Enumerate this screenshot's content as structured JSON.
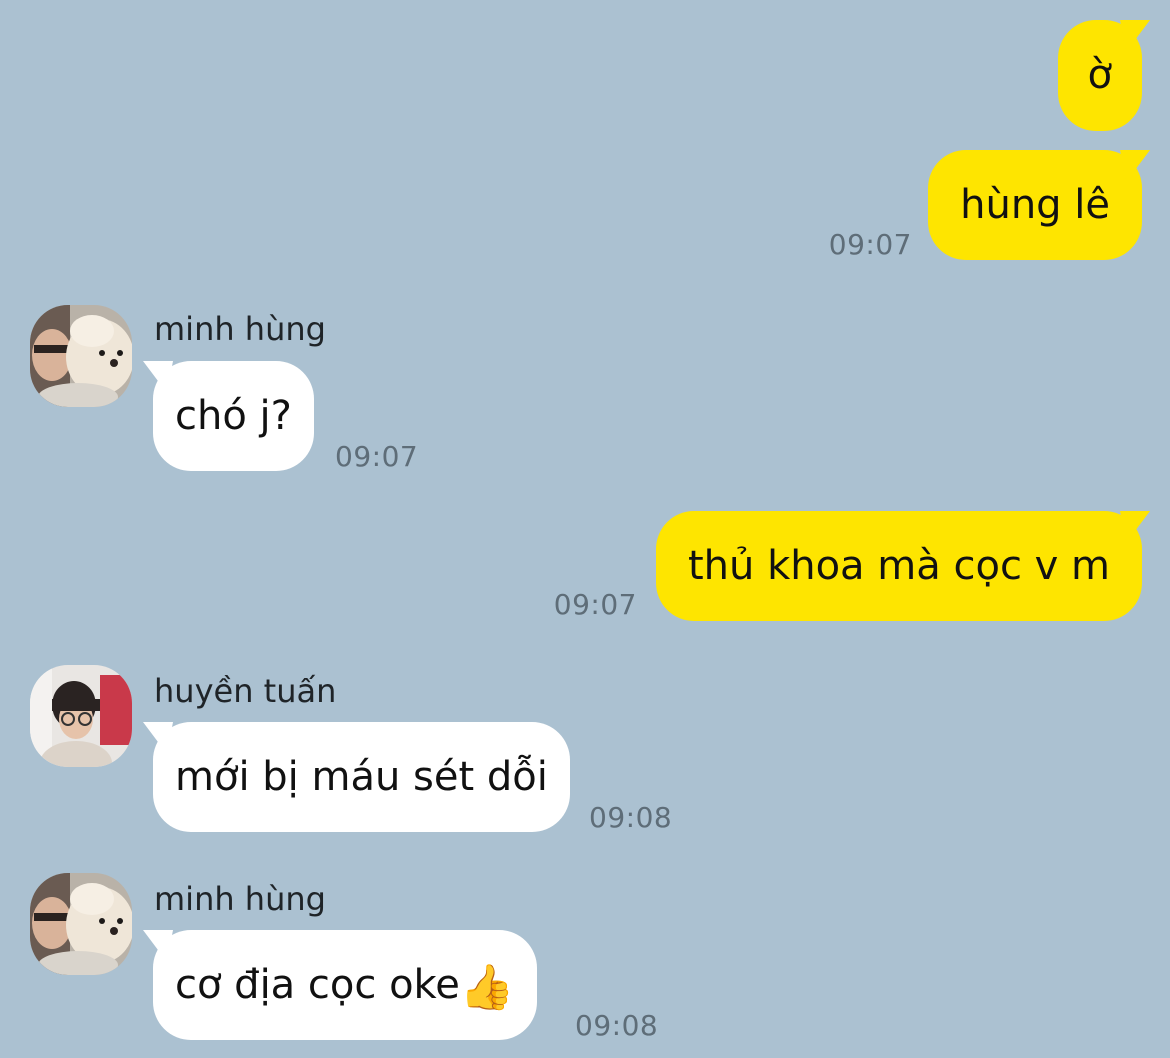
{
  "messages": [
    {
      "sender": "",
      "text": "ờ",
      "time": ""
    },
    {
      "sender": "",
      "text": "hùng lê",
      "time": "09:07"
    },
    {
      "sender": "minh hùng",
      "text": "chó j?",
      "time": "09:07"
    },
    {
      "sender": "",
      "text": "thủ khoa mà cọc v m",
      "time": "09:07"
    },
    {
      "sender": "huyền tuấn",
      "text": "mới bị máu sét dỗi",
      "time": "09:08"
    },
    {
      "sender": "minh hùng",
      "text": "cơ địa cọc oke",
      "emoji": "👍",
      "time": "09:08"
    }
  ],
  "colors": {
    "background": "#abc1d1",
    "outgoing_bubble": "#fee500",
    "incoming_bubble": "#ffffff",
    "timestamp": "#5e6d78"
  },
  "icons": {
    "minh_hung_avatar": "avatar-photo-person-with-white-dog",
    "huyen_tuan_avatar": "avatar-photo-person-with-glasses"
  }
}
